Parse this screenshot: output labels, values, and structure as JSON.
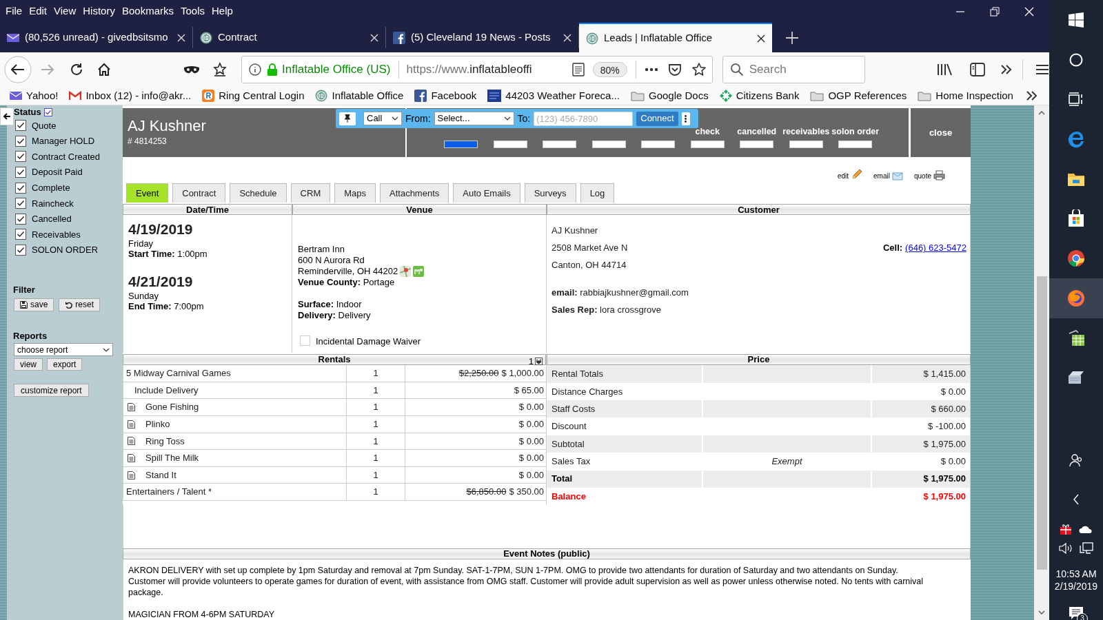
{
  "menu_bar": [
    "File",
    "Edit",
    "View",
    "History",
    "Bookmarks",
    "Tools",
    "Help"
  ],
  "browser_tabs": [
    {
      "title": "(80,526 unread) - givedbsitsmo",
      "kind": "mail",
      "selected": false
    },
    {
      "title": "Contract",
      "kind": "io",
      "selected": false
    },
    {
      "title": "(5) Cleveland 19 News - Posts",
      "kind": "facebook",
      "selected": false
    },
    {
      "title": "Leads | Inflatable Office",
      "kind": "io",
      "selected": true
    }
  ],
  "address_bar": {
    "site_identity": "Inflatable Office (US)",
    "url_prefix": "https://www.",
    "url_domain": "inflatableoffi",
    "zoom": "80%"
  },
  "search": {
    "placeholder": "Search"
  },
  "bookmarks": [
    {
      "label": "Yahoo!",
      "kind": "mail"
    },
    {
      "label": "Inbox (12) - info@akr...",
      "kind": "gmail"
    },
    {
      "label": "Ring Central Login",
      "kind": "ring"
    },
    {
      "label": "Inflatable Office",
      "kind": "io"
    },
    {
      "label": "Facebook",
      "kind": "facebook"
    },
    {
      "label": "44203 Weather Foreca...",
      "kind": "weather"
    },
    {
      "label": "Google Docs",
      "kind": "folder"
    },
    {
      "label": "Citizens Bank",
      "kind": "bank"
    },
    {
      "label": "OGP References",
      "kind": "folder"
    },
    {
      "label": "Home Inspection",
      "kind": "folder"
    }
  ],
  "sidebar": {
    "status_title": "Status",
    "statuses": [
      {
        "label": "Quote",
        "checked": true
      },
      {
        "label": "Manager HOLD",
        "checked": true
      },
      {
        "label": "Contract Created",
        "checked": true
      },
      {
        "label": "Deposit Paid",
        "checked": true
      },
      {
        "label": "Complete",
        "checked": true
      },
      {
        "label": "Raincheck",
        "checked": true
      },
      {
        "label": "Cancelled",
        "checked": true
      },
      {
        "label": "Receivables",
        "checked": true
      },
      {
        "label": "SOLON ORDER",
        "checked": true
      }
    ],
    "filter_title": "Filter",
    "filter_buttons": [
      {
        "label": "save",
        "kind": "save"
      },
      {
        "label": "reset",
        "kind": "reset"
      }
    ],
    "reports_title": "Reports",
    "report_select": "choose report",
    "report_buttons": [
      "view",
      "export"
    ],
    "customize_button": "customize report"
  },
  "lead": {
    "name": "AJ Kushner",
    "number": "# 4814253",
    "close": "close",
    "status_track": [
      {
        "selected": true
      },
      {
        "selected": false
      },
      {
        "selected": false
      },
      {
        "selected": false
      },
      {
        "selected": false
      },
      {
        "label": "check",
        "selected": false
      },
      {
        "label": "cancelled",
        "selected": false
      },
      {
        "label": "receivables",
        "selected": false
      },
      {
        "label": "solon order",
        "selected": false
      }
    ]
  },
  "call_bar": {
    "mode": "Call",
    "from_label": "From:",
    "from_value": "Select...",
    "to_label": "To:",
    "to_placeholder": "(123) 456-7890",
    "connect": "Connect"
  },
  "actions": [
    {
      "label": "edit",
      "kind": "edit"
    },
    {
      "label": "email",
      "kind": "email"
    },
    {
      "label": "quote",
      "kind": "quote"
    }
  ],
  "tabs": [
    {
      "label": "Event",
      "selected": true
    },
    {
      "label": "Contract",
      "selected": false
    },
    {
      "label": "Schedule",
      "selected": false
    },
    {
      "label": "CRM",
      "selected": false
    },
    {
      "label": "Maps",
      "selected": false
    },
    {
      "label": "Attachments",
      "selected": false
    },
    {
      "label": "Auto Emails",
      "selected": false
    },
    {
      "label": "Surveys",
      "selected": false
    },
    {
      "label": "Log",
      "selected": false
    }
  ],
  "event": {
    "headers": [
      "Date/Time",
      "Venue",
      "Customer"
    ],
    "dates": [
      {
        "date": "4/19/2019",
        "weekday": "Friday",
        "time_label": "Start Time:",
        "time": "1:00pm"
      },
      {
        "date": "4/21/2019",
        "weekday": "Sunday",
        "time_label": "End Time:",
        "time": "7:00pm"
      }
    ],
    "venue": {
      "lines": [
        "Bertram Inn",
        "600 N Aurora Rd",
        "Reminderville, OH 44202"
      ],
      "county_label": "Venue County:",
      "county": "Portage",
      "surface_label": "Surface:",
      "surface": "Indoor",
      "delivery_label": "Delivery:",
      "delivery": "Delivery",
      "waiver": {
        "label": "Incidental Damage Waiver",
        "checked": false
      }
    },
    "customer": {
      "name": "AJ Kushner",
      "address": [
        "2508 Market Ave N",
        "Canton, OH 44714"
      ],
      "cell_label": "Cell:",
      "cell": "(646) 623-5472",
      "email_label": "email:",
      "email": "rabbiajkushner@gmail.com",
      "rep_label": "Sales Rep:",
      "rep": "lora crossgrove"
    }
  },
  "rentals": {
    "title": "Rentals",
    "count": "1",
    "rows": [
      {
        "name": "5 Midway Carnival Games",
        "kind": "package",
        "qty": "1",
        "old_price": "$2,250.00",
        "price": "$ 1,000.00"
      },
      {
        "name": "Include Delivery",
        "kind": "addon",
        "qty": "1",
        "price": "$ 65.00"
      },
      {
        "name": "Gone Fishing",
        "kind": "component",
        "qty": "1",
        "price": "$ 0.00"
      },
      {
        "name": "Plinko",
        "kind": "component",
        "qty": "1",
        "price": "$ 0.00"
      },
      {
        "name": "Ring Toss",
        "kind": "component",
        "qty": "1",
        "price": "$ 0.00"
      },
      {
        "name": "Spill The Milk",
        "kind": "component",
        "qty": "1",
        "price": "$ 0.00"
      },
      {
        "name": "Stand It",
        "kind": "component",
        "qty": "1",
        "price": "$ 0.00"
      },
      {
        "name": "Entertainers / Talent *",
        "kind": "package",
        "qty": "1",
        "old_price": "$6,850.00",
        "price": "$ 350.00"
      }
    ]
  },
  "price": {
    "title": "Price",
    "rows": [
      {
        "label": "Rental Totals",
        "value": "$ 1,415.00",
        "kind": "normal"
      },
      {
        "label": "Distance Charges",
        "value": "$ 0.00",
        "kind": "normal"
      },
      {
        "label": "Staff Costs",
        "value": "$ 660.00",
        "kind": "normal"
      },
      {
        "label": "Discount",
        "value": "$ -100.00",
        "kind": "normal"
      },
      {
        "label": "Subtotal",
        "value": "$ 1,975.00",
        "kind": "normal"
      },
      {
        "label": "Sales Tax",
        "note": "Exempt",
        "value": "$ 0.00",
        "kind": "normal"
      },
      {
        "label": "Total",
        "value": "$ 1,975.00",
        "kind": "total"
      },
      {
        "label": "Balance",
        "value": "$ 1,975.00",
        "kind": "balance"
      }
    ]
  },
  "notes": {
    "title": "Event Notes (public)",
    "paragraphs": [
      "AKRON DELIVERY with set up complete by 1pm Saturday and removal at 7pm Sunday. SAT-1-7PM, SUN 1-7PM. OMG to provide two attendants for duration of Saturday and two attendants on Sunday. Customer will provide volunteers to operate games for duration of event, with assistance from OMG staff. Customer will provide adult supervision as well as power unless otherwise noted. No tents with carnival package.",
      "MAGICIAN FROM 4-6PM SATURDAY"
    ]
  },
  "taskbar": {
    "time": "10:53 AM",
    "date": "2/19/2019",
    "notifications": "3"
  }
}
